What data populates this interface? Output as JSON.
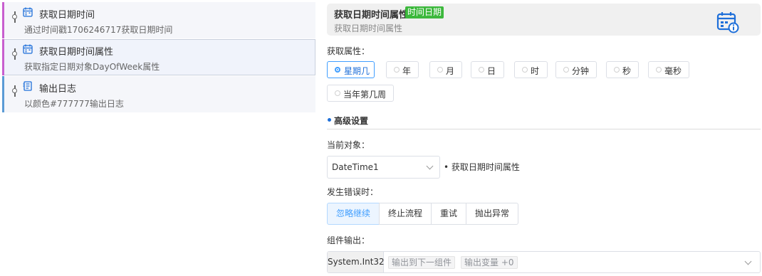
{
  "steps": [
    {
      "title": "获取日期时间",
      "desc": "通过时间戳1706246717获取日期时间",
      "icon": "calendar-icon",
      "accent": "#c85fcf"
    },
    {
      "title": "获取日期时间属性",
      "desc": "获取指定日期对象DayOfWeek属性",
      "icon": "calendar-icon",
      "accent": "#c85fcf"
    },
    {
      "title": "输出日志",
      "desc": "以颜色#777777输出日志",
      "icon": "log-icon",
      "accent": "#5b9bd5"
    }
  ],
  "header": {
    "title": "获取日期时间属性",
    "tag": "时间日期",
    "subtitle": "获取日期时间属性",
    "tag_color": "#3cb83c"
  },
  "property": {
    "label": "获取属性：",
    "options": [
      "星期几",
      "年",
      "月",
      "日",
      "时",
      "分钟",
      "秒",
      "毫秒",
      "当年第几周"
    ],
    "selected": "星期几"
  },
  "advanced": {
    "label": "高级设置"
  },
  "current_object": {
    "label": "当前对象：",
    "value": "DateTime1",
    "note": "• 获取日期时间属性"
  },
  "on_error": {
    "label": "发生错误时：",
    "options": [
      "忽略继续",
      "终止流程",
      "重试",
      "抛出异常"
    ],
    "selected": "忽略继续"
  },
  "output": {
    "label": "组件输出：",
    "type": "System.Int32",
    "chips": [
      "输出到下一组件",
      "输出变量 +0"
    ]
  },
  "colors": {
    "accent": "#409eff",
    "brand_blue": "#1e6fd9"
  }
}
